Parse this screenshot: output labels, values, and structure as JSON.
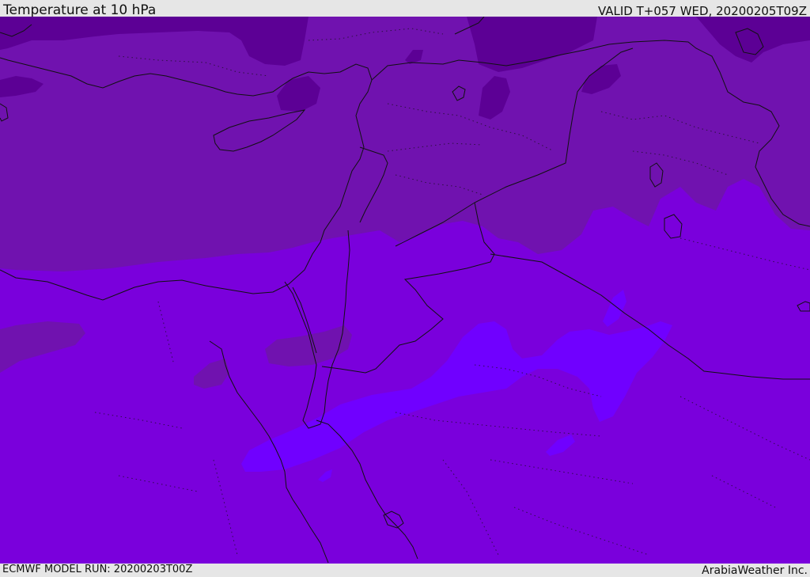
{
  "header": {
    "title": "Temperature at 10 hPa",
    "valid": "VALID T+057 WED, 20200205T09Z"
  },
  "footer": {
    "model_run": "ECMWF MODEL RUN: 20200203T00Z",
    "credit": "ArabiaWeather Inc."
  },
  "colors": {
    "band_darkest": "#5c0095",
    "band_dark": "#7012af",
    "band_mid": "#7a00dc",
    "band_light": "#7000ff",
    "band_lightest": "#7b2cff",
    "coastline": "#111111"
  }
}
